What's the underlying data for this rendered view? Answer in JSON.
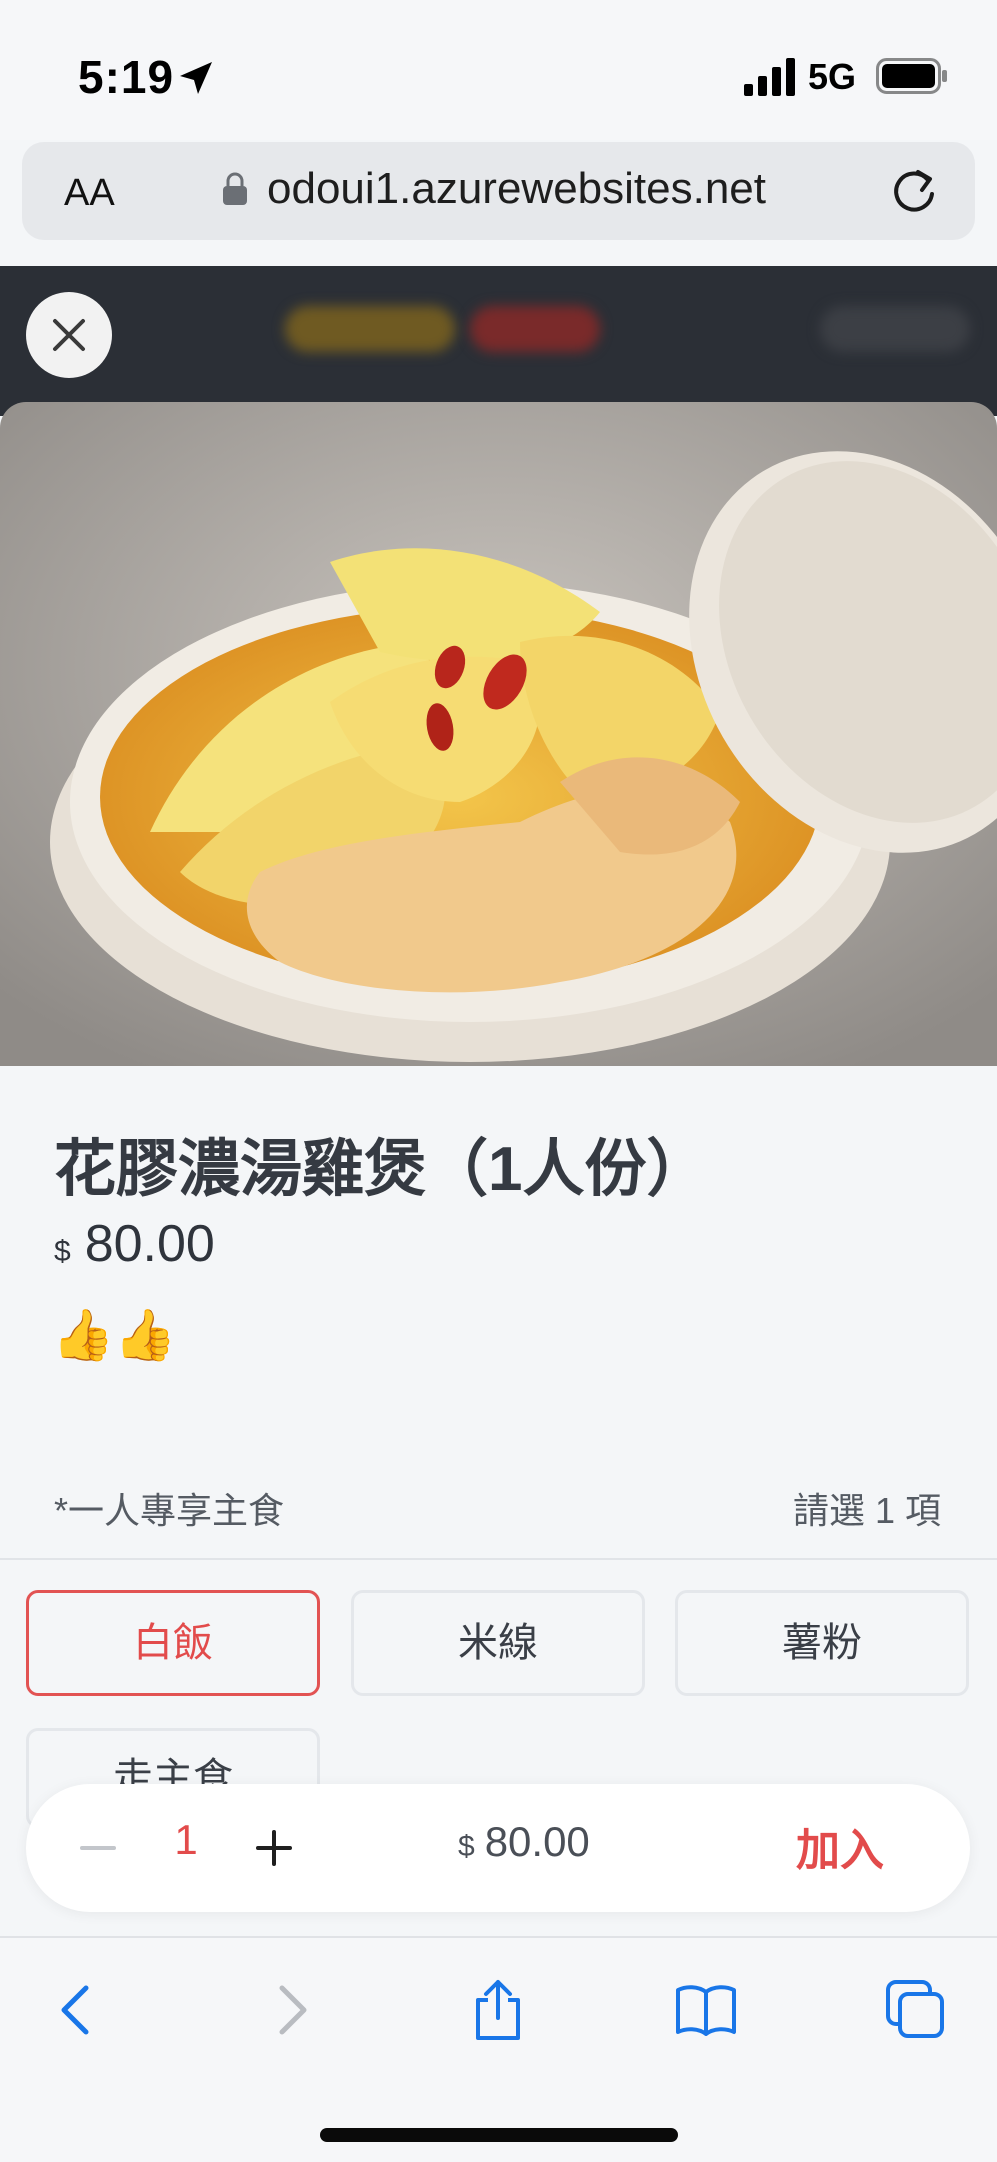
{
  "status": {
    "time": "5:19",
    "network": "5G"
  },
  "browser": {
    "text_size_label": "AA",
    "url": "odoui1.azurewebsites.net"
  },
  "product": {
    "name": "花膠濃湯雞煲（1人份）",
    "currency": "$",
    "price": "80.00",
    "description": "👍👍"
  },
  "options": {
    "group_label": "*一人專享主食",
    "hint": "請選 1 項",
    "items": [
      "白飯",
      "米線",
      "薯粉",
      "走主食"
    ],
    "selected": "白飯"
  },
  "order": {
    "quantity": "1",
    "currency": "$",
    "total": "80.00",
    "add_label": "加入"
  },
  "colors": {
    "accent": "#e24b4b",
    "background": "#f4f6f8",
    "header_dark": "#2b2f36"
  }
}
